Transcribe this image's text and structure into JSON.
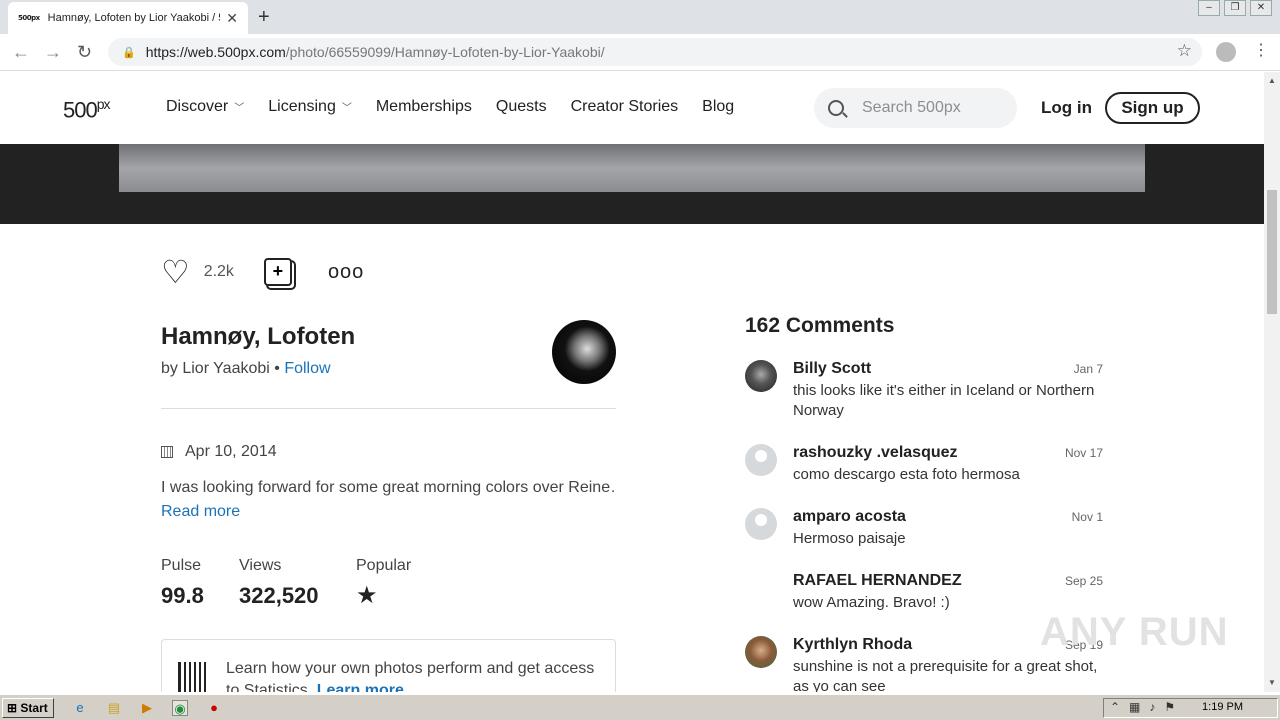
{
  "browser": {
    "tab_title": "Hamnøy, Lofoten by Lior Yaakobi / 5",
    "tab_favicon": "500px",
    "url_host": "https://web.500px.com",
    "url_path": "/photo/66559099/Hamnøy-Lofoten-by-Lior-Yaakobi/"
  },
  "site": {
    "logo": "500",
    "logo_suffix": "px",
    "nav": [
      {
        "label": "Discover",
        "chevron": true
      },
      {
        "label": "Licensing",
        "chevron": true
      },
      {
        "label": "Memberships"
      },
      {
        "label": "Quests"
      },
      {
        "label": "Creator Stories"
      },
      {
        "label": "Blog"
      }
    ],
    "search_placeholder": "Search 500px",
    "login": "Log in",
    "signup": "Sign up"
  },
  "photo": {
    "likes": "2.2k",
    "title": "Hamnøy, Lofoten",
    "by": "by Lior Yaakobi •",
    "follow": "Follow",
    "date": "Apr 10, 2014",
    "description": "I was looking forward for some great morning colors over Reine…",
    "read_more": "Read more",
    "stats": [
      {
        "label": "Pulse",
        "value": "99.8"
      },
      {
        "label": "Views",
        "value": "322,520"
      },
      {
        "label": "Popular",
        "value": "★"
      }
    ],
    "statistics_promo": "Learn how your own photos perform and get access to Statistics.",
    "statistics_link": "Learn more"
  },
  "comments": {
    "title": "162 Comments",
    "items": [
      {
        "name": "Billy Scott",
        "date": "Jan 7",
        "text": "this looks like it's either in Iceland or Northern Norway",
        "avatar": "photo1"
      },
      {
        "name": "rashouzky .velasquez",
        "date": "Nov 17",
        "text": "como descargo esta foto hermosa",
        "avatar": "default"
      },
      {
        "name": "amparo acosta",
        "date": "Nov 1",
        "text": "Hermoso paisaje",
        "avatar": "default"
      },
      {
        "name": "RAFAEL HERNANDEZ",
        "date": "Sep 25",
        "text": "wow Amazing. Bravo! :)",
        "avatar": "apple"
      },
      {
        "name": "Kyrthlyn Rhoda",
        "date": "Sep 19",
        "text": "sunshine is not a prerequisite for a great shot, as yo can see",
        "avatar": "photo2"
      }
    ]
  },
  "watermark": "ANY RUN",
  "taskbar": {
    "start": "Start",
    "clock": "1:19 PM"
  }
}
